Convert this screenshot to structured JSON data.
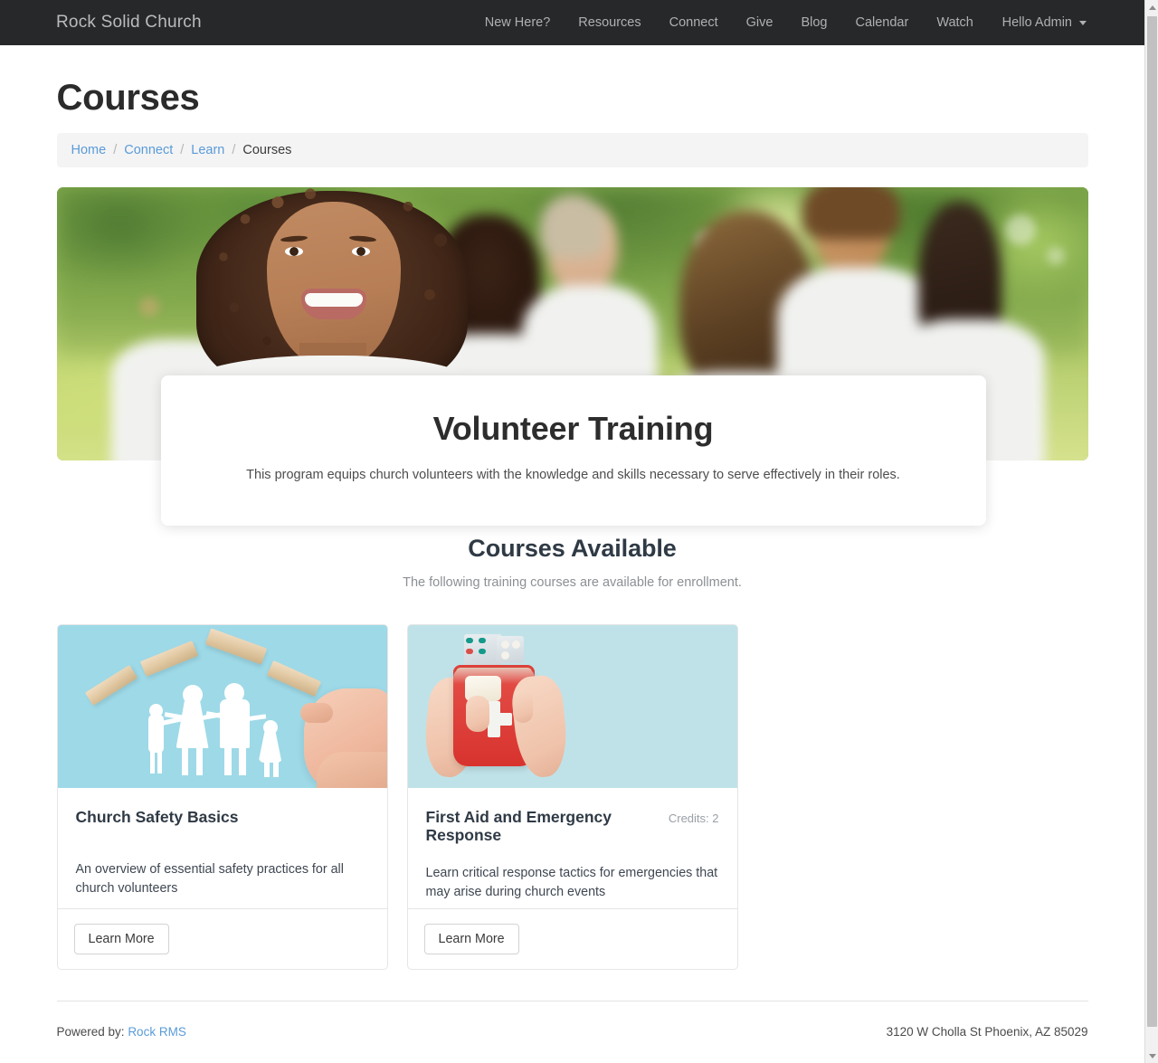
{
  "navbar": {
    "brand": "Rock Solid Church",
    "links": [
      {
        "label": "New Here?"
      },
      {
        "label": "Resources"
      },
      {
        "label": "Connect"
      },
      {
        "label": "Give"
      },
      {
        "label": "Blog"
      },
      {
        "label": "Calendar"
      },
      {
        "label": "Watch"
      }
    ],
    "account": "Hello Admin",
    "account_caret": "chevron-down-icon",
    "background_color": "#26282a",
    "link_color": "#aeb0b2"
  },
  "page": {
    "title": "Courses"
  },
  "breadcrumb": {
    "items": [
      {
        "label": "Home",
        "link": true
      },
      {
        "label": "Connect",
        "link": true
      },
      {
        "label": "Learn",
        "link": true
      },
      {
        "label": "Courses",
        "link": false
      }
    ],
    "separator": "/",
    "link_color": "#5a9bd8",
    "background_color": "#f4f4f5"
  },
  "hero": {
    "image_alt": "Group of smiling volunteers in white t-shirts outdoors in a park",
    "card": {
      "title": "Volunteer Training",
      "description": "This program equips church volunteers with the knowledge and skills necessary to serve effectively in their roles."
    }
  },
  "courses_section": {
    "heading": "Courses Available",
    "subheading": "The following training courses are available for enrollment.",
    "cards": [
      {
        "title": "Church Safety Basics",
        "credits": "",
        "description": "An overview of essential safety practices for all church volunteers",
        "button_label": "Learn More",
        "image_alt": "Paper cut-out family sheltered under wooden blocks forming a roof on a light blue background"
      },
      {
        "title": "First Aid and Emergency Response",
        "credits": "Credits: 2",
        "description": "Learn critical response tactics for emergencies that may arise during church events",
        "button_label": "Learn More",
        "image_alt": "Hands holding an open red first aid kit with bandage and pills on a light blue background"
      }
    ]
  },
  "footer": {
    "powered_by_label": "Powered by:",
    "powered_by_link": "Rock RMS",
    "address": "3120 W Cholla St Phoenix, AZ 85029"
  },
  "scrollbar": {
    "up_arrow": "triangle-up-icon",
    "down_arrow": "triangle-down-icon"
  }
}
